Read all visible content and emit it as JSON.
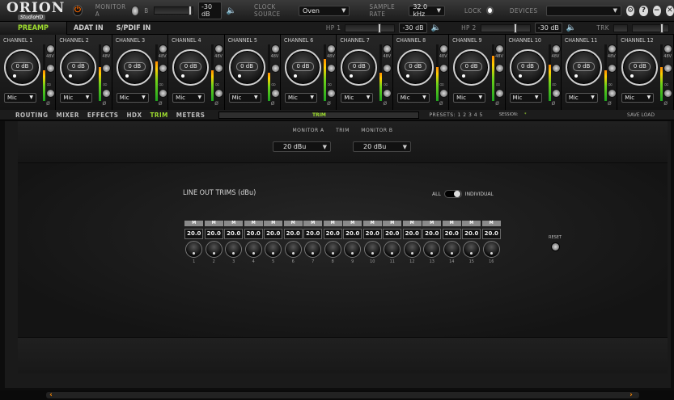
{
  "topbar": {
    "brand": "ORION",
    "brand_sub": "StudioHD",
    "monitor_label": "MONITOR A",
    "monitor_suffix": "B",
    "monitor_db": "-30 dB",
    "clock_source_label": "CLOCK SOURCE",
    "clock_source_value": "Oven",
    "sample_rate_label": "SAMPLE RATE",
    "sample_rate_value": "32.0 kHz",
    "lock_label": "LOCK",
    "devices_label": "DEVICES",
    "devices_value": ""
  },
  "tabrow": {
    "tabs": [
      "PREAMP",
      "ADAT IN",
      "S/PDIF IN"
    ],
    "hp1_label": "HP 1",
    "hp1_db": "-30 dB",
    "hp2_label": "HP 2",
    "hp2_db": "-30 dB",
    "trk_label": "TRK"
  },
  "channels": [
    {
      "name": "CHANNEL 1",
      "gain": "0 dB",
      "input": "Mic",
      "v48": "48V",
      "level": 0.55
    },
    {
      "name": "CHANNEL 2",
      "gain": "0 dB",
      "input": "Mic",
      "v48": "48V",
      "level": 0.6
    },
    {
      "name": "CHANNEL 3",
      "gain": "0 dB",
      "input": "Mic",
      "v48": "48V",
      "level": 0.7
    },
    {
      "name": "CHANNEL 4",
      "gain": "0 dB",
      "input": "Mic",
      "v48": "48V",
      "level": 0.55
    },
    {
      "name": "CHANNEL 5",
      "gain": "0 dB",
      "input": "Mic",
      "v48": "48V",
      "level": 0.5
    },
    {
      "name": "CHANNEL 6",
      "gain": "0 dB",
      "input": "Mic",
      "v48": "48V",
      "level": 0.75
    },
    {
      "name": "CHANNEL 7",
      "gain": "0 dB",
      "input": "Mic",
      "v48": "48V",
      "level": 0.5
    },
    {
      "name": "CHANNEL 8",
      "gain": "0 dB",
      "input": "Mic",
      "v48": "48V",
      "level": 0.6
    },
    {
      "name": "CHANNEL 9",
      "gain": "0 dB",
      "input": "Mic",
      "v48": "48V",
      "level": 0.8
    },
    {
      "name": "CHANNEL 10",
      "gain": "0 dB",
      "input": "Mic",
      "v48": "48V",
      "level": 0.65
    },
    {
      "name": "CHANNEL 11",
      "gain": "0 dB",
      "input": "Mic",
      "v48": "48V",
      "level": 0.55
    },
    {
      "name": "CHANNEL 12",
      "gain": "0 dB",
      "input": "Mic",
      "v48": "48V",
      "level": 0.6
    }
  ],
  "nav": {
    "items": [
      "ROUTING",
      "MIXER",
      "EFFECTS",
      "HDX",
      "TRIM",
      "METERS"
    ],
    "active": "TRIM",
    "current_view": "TRIM",
    "presets_label": "PRESETS:",
    "presets": [
      "1",
      "2",
      "3",
      "4",
      "5"
    ],
    "session_label": "SESSION:",
    "session_value": "*",
    "save_label": "SAVE",
    "load_label": "LOAD"
  },
  "monitor": {
    "label_a": "MONITOR A",
    "label_trim": "TRIM",
    "label_b": "MONITOR B",
    "value_a": "20 dBu",
    "value_b": "20 dBu"
  },
  "trim": {
    "title": "LINE OUT TRIMS (dBu)",
    "all_label": "ALL",
    "individual_label": "INDIVIDUAL",
    "reset_label": "RESET",
    "outputs": [
      {
        "mute": "M",
        "value": "20.0",
        "num": "1"
      },
      {
        "mute": "M",
        "value": "20.0",
        "num": "2"
      },
      {
        "mute": "M",
        "value": "20.0",
        "num": "3"
      },
      {
        "mute": "M",
        "value": "20.0",
        "num": "4"
      },
      {
        "mute": "M",
        "value": "20.0",
        "num": "5"
      },
      {
        "mute": "M",
        "value": "20.0",
        "num": "6"
      },
      {
        "mute": "M",
        "value": "20.0",
        "num": "7"
      },
      {
        "mute": "M",
        "value": "20.0",
        "num": "8"
      },
      {
        "mute": "M",
        "value": "20.0",
        "num": "9"
      },
      {
        "mute": "M",
        "value": "20.0",
        "num": "10"
      },
      {
        "mute": "M",
        "value": "20.0",
        "num": "11"
      },
      {
        "mute": "M",
        "value": "20.0",
        "num": "12"
      },
      {
        "mute": "M",
        "value": "20.0",
        "num": "13"
      },
      {
        "mute": "M",
        "value": "20.0",
        "num": "14"
      },
      {
        "mute": "M",
        "value": "20.0",
        "num": "15"
      },
      {
        "mute": "M",
        "value": "20.0",
        "num": "16"
      }
    ]
  },
  "colors": {
    "accent_green": "#9edc2f",
    "power_orange": "#ff6a00",
    "scroll_arrow": "#ff8a00"
  }
}
